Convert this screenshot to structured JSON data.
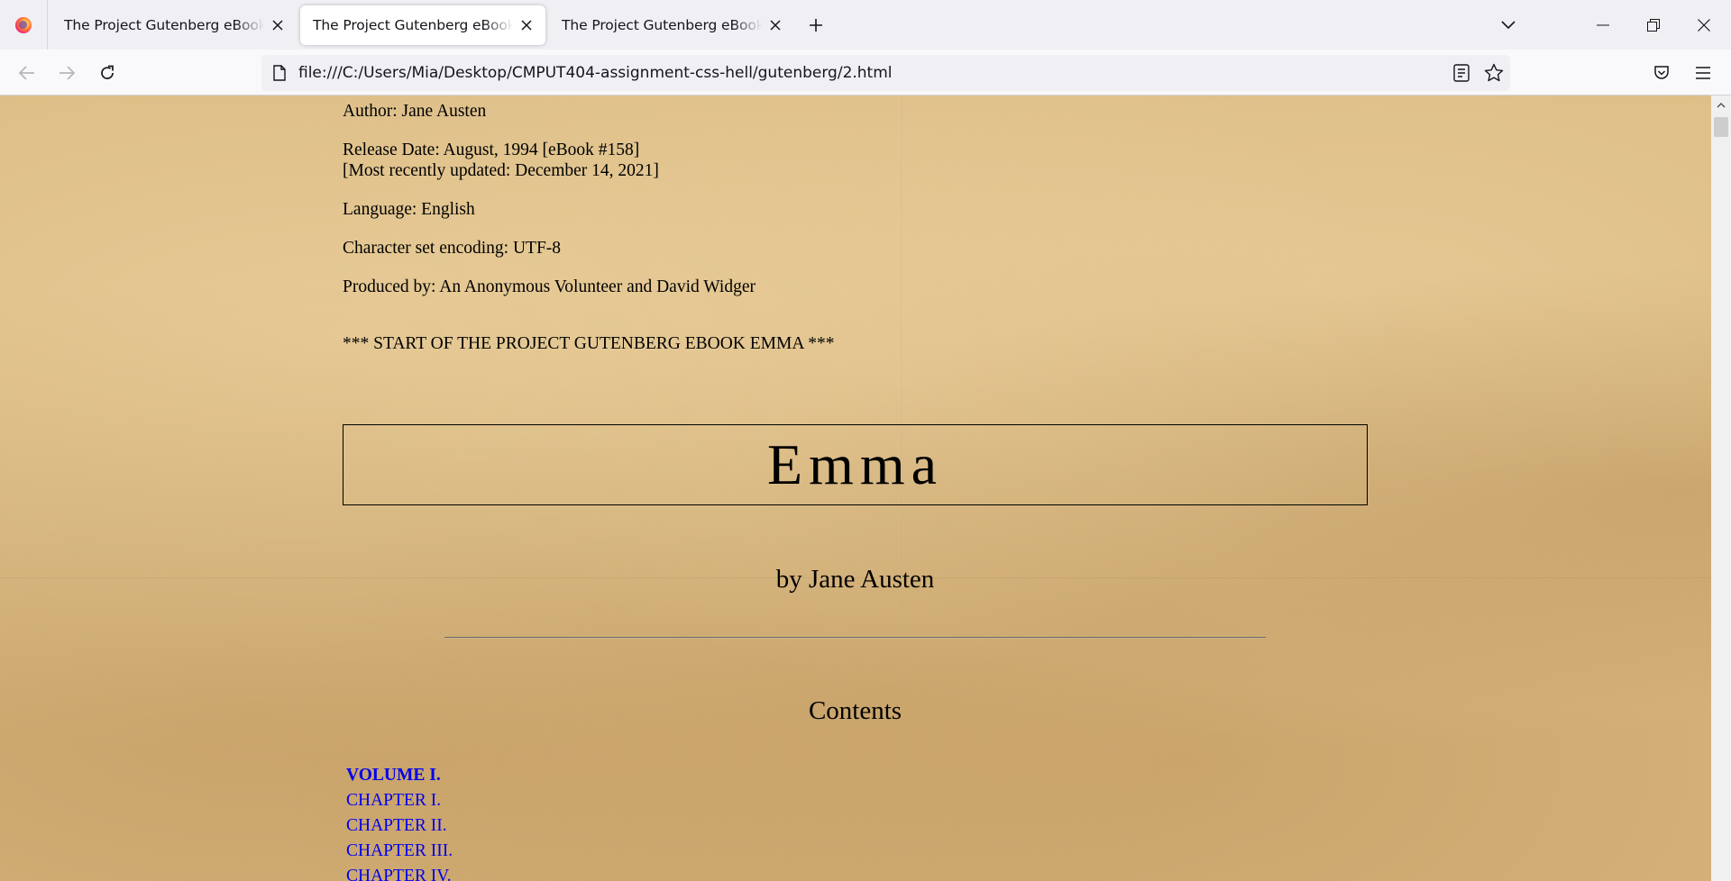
{
  "browser": {
    "tabs": [
      {
        "title": "The Project Gutenberg eBook of Emma, by Jane Austen",
        "active": false
      },
      {
        "title": "The Project Gutenberg eBook of Emma, by Jane Austen",
        "active": true
      },
      {
        "title": "The Project Gutenberg eBook of Emma, by Jane Austen",
        "active": false
      }
    ],
    "url": "file:///C:/Users/Mia/Desktop/CMPUT404-assignment-css-hell/gutenberg/2.html",
    "icons": {
      "firefox": "firefox-logo-icon",
      "close": "×",
      "new_tab": "+",
      "back": "back-arrow-icon",
      "forward": "forward-arrow-icon",
      "reload": "reload-icon",
      "page": "page-icon",
      "reader": "reader-view-icon",
      "bookmark": "star-icon",
      "pocket": "pocket-icon",
      "menu": "hamburger-menu-icon"
    }
  },
  "page": {
    "author": "Author: Jane Austen",
    "release_date": "Release Date: August, 1994 [eBook #158]",
    "updated": "[Most recently updated: December 14, 2021]",
    "language": "Language: English",
    "encoding": "Character set encoding: UTF-8",
    "produced_by": "Produced by: An Anonymous Volunteer and David Widger",
    "start_marker": "*** START OF THE PROJECT GUTENBERG EBOOK EMMA ***",
    "title": "Emma",
    "byline": "by Jane Austen",
    "contents_heading": "Contents",
    "toc": [
      {
        "label": "VOLUME I.",
        "bold": true
      },
      {
        "label": "CHAPTER I.",
        "bold": false
      },
      {
        "label": "CHAPTER II.",
        "bold": false
      },
      {
        "label": "CHAPTER III.",
        "bold": false
      },
      {
        "label": "CHAPTER IV.",
        "bold": false
      }
    ],
    "colors": {
      "link": "#0000ee",
      "parchment": "#d9b880"
    }
  }
}
